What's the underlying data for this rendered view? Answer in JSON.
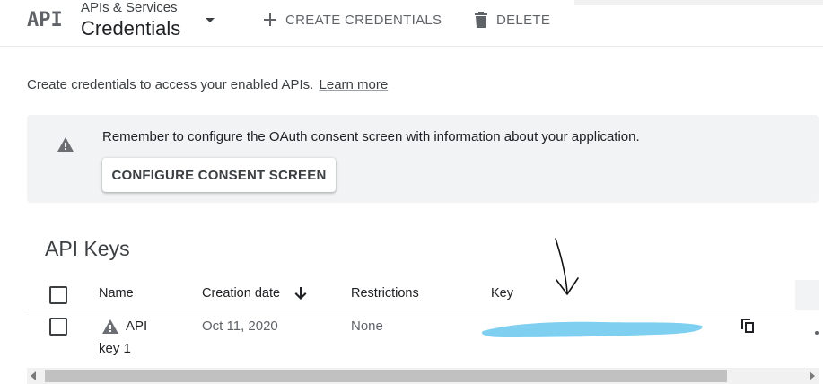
{
  "header": {
    "logo_text": "API",
    "breadcrumb_parent": "APIs & Services",
    "page_title": "Credentials",
    "create_label": "CREATE CREDENTIALS",
    "delete_label": "DELETE"
  },
  "intro": {
    "text": "Create credentials to access your enabled APIs.",
    "learn_more": "Learn more"
  },
  "banner": {
    "message": "Remember to configure the OAuth consent screen with information about your application.",
    "button_label": "CONFIGURE CONSENT SCREEN"
  },
  "api_keys": {
    "title": "API Keys",
    "columns": {
      "name": "Name",
      "creation_date": "Creation date",
      "restrictions": "Restrictions",
      "key": "Key"
    },
    "rows": [
      {
        "name_line1": "API",
        "name_line2": "key 1",
        "creation_date": "Oct 11, 2020",
        "restrictions": "None",
        "key_redacted": true
      }
    ]
  },
  "colors": {
    "banner_bg": "#f1f3f4",
    "text_secondary": "#5f6368",
    "redaction": "#7fd0f0"
  },
  "icons": {
    "create": "plus-icon",
    "delete": "trash-icon",
    "warning": "warning-icon",
    "sort": "arrow-down-icon",
    "copy": "copy-icon",
    "dropdown": "caret-down-icon"
  }
}
